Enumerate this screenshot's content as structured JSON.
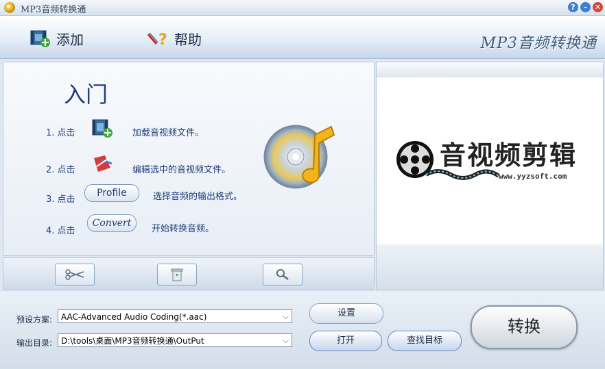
{
  "window": {
    "title": "MP3音频转换通"
  },
  "toolbar": {
    "add_label": "添加",
    "help_label": "帮助",
    "brand": "MP3音频转换通"
  },
  "guide": {
    "title": "入门",
    "steps": [
      {
        "prefix": "1. 点击",
        "text": "加载音视频文件。"
      },
      {
        "prefix": "2. 点击",
        "text": "编辑选中的音视频文件。"
      },
      {
        "prefix": "3. 点击",
        "button": "Profile",
        "text": "选择音频的输出格式。"
      },
      {
        "prefix": "4. 点击",
        "button": "Convert",
        "text": "开始转换音频。"
      }
    ]
  },
  "preview": {
    "logo_text": "音视频剪辑",
    "url": "www.yyzsoft.com"
  },
  "settings": {
    "preset_label": "预设方案:",
    "preset_value": "AAC-Advanced Audio Coding(*.aac)",
    "output_label": "输出目录:",
    "output_value": "D:\\tools\\桌面\\MP3音频转换通\\OutPut",
    "settings_button": "设置",
    "open_button": "打开",
    "find_button": "查找目标",
    "convert_button": "转换"
  },
  "colors": {
    "accent": "#1f3d78",
    "toolbar": "#dbe6f3"
  }
}
